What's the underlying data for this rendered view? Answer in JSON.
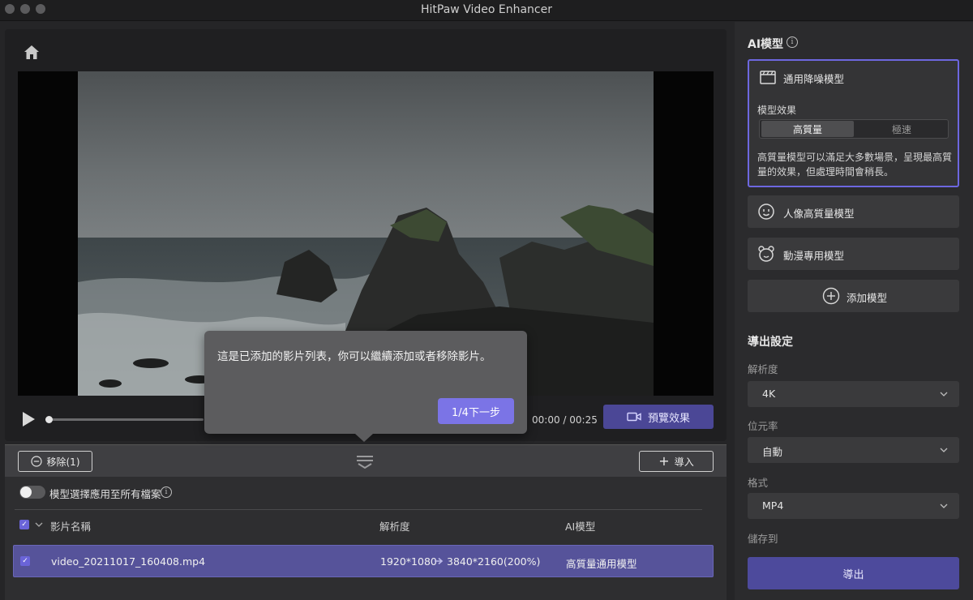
{
  "window": {
    "title": "HitPaw Video Enhancer"
  },
  "player": {
    "time": "00:00 / 00:25",
    "preview_label": "預覽效果"
  },
  "tooltip": {
    "text": "這是已添加的影片列表，你可以繼續添加或者移除影片。",
    "next_label": "1/4下一步"
  },
  "toolbar": {
    "remove_label": "移除(1)",
    "import_label": "導入"
  },
  "list": {
    "apply_all_label": "模型選擇應用至所有檔案",
    "columns": {
      "name": "影片名稱",
      "resolution": "解析度",
      "ai_model": "AI模型"
    },
    "rows": [
      {
        "name": "video_20211017_160408.mp4",
        "res_from": "1920*1080",
        "res_to": "3840*2160(200%)",
        "model": "高質量通用模型"
      }
    ]
  },
  "ai_models": {
    "title": "AI模型",
    "items": [
      {
        "label": "通用降噪模型",
        "icon": "film-icon"
      },
      {
        "label": "人像高質量模型",
        "icon": "face-icon"
      },
      {
        "label": "動漫專用模型",
        "icon": "bear-icon"
      }
    ],
    "effect_label": "模型效果",
    "effect_options": [
      "高質量",
      "極速"
    ],
    "effect_selected": "高質量",
    "description": "高質量模型可以滿足大多數場景，呈現最高質量的效果，但處理時間會稍長。",
    "add_label": "添加模型"
  },
  "export_settings": {
    "title": "導出設定",
    "resolution_label": "解析度",
    "resolution_value": "4K",
    "bitrate_label": "位元率",
    "bitrate_value": "自動",
    "format_label": "格式",
    "format_value": "MP4",
    "save_to_label": "儲存到",
    "export_label": "導出"
  },
  "colors": {
    "accent": "#6d67e0",
    "selected_row": "#56539a",
    "export": "#4d4a9c"
  }
}
